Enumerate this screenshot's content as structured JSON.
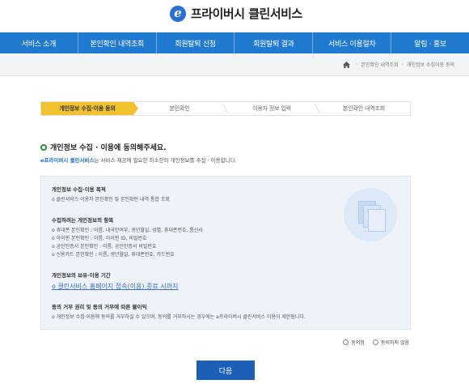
{
  "app": {
    "logo_mark": "e",
    "title": "프라이버시 클린서비스"
  },
  "nav": {
    "items": [
      "서비스 소개",
      "본인확인 내역조회",
      "회원탈퇴 신청",
      "회원탈퇴 결과",
      "서비스 이용절차",
      "알림 · 홍보"
    ]
  },
  "breadcrumb": {
    "items": [
      "본인확인 내역조회",
      "개인정보 수집이용 동의"
    ]
  },
  "steps": {
    "items": [
      "개인정보 수집·이용 동의",
      "본인확인",
      "이용자 정보 입력",
      "본인확인 내역조회"
    ],
    "active_index": 0
  },
  "main": {
    "section_title": "개인정보 수집 · 이용에 동의해주세요.",
    "intro_brand": "e프라이버시 클린서비스",
    "intro_text": "는 서비스 제공에 필요한 최소한의 개인정보를 수집 · 이용합니다."
  },
  "consent": {
    "purpose_title": "개인정보 수집·이용 목적",
    "purpose_items": [
      "o 클린서비스 이용자 본인확인 및 본인확인 내역 통합 조회"
    ],
    "items_title": "수집하려는 개인정보의 항목",
    "items_list": [
      "o 휴대폰 본인확인 : 이름, 내국인여부, 생년월일, 성별, 휴대폰번호, 통신사",
      "o 아이핀 본인확인 : 이름, 아이핀 ID, 비밀번호",
      "o 공인인증서 본인확인 : 이름, 공인인증서 비밀번호",
      "o 신용카드 본인확인 : 이름, 생년월일, 휴대폰번호, 카드번호"
    ],
    "period_title": "개인정보의 보유·이용 기간",
    "period_link": "o 클린서비스 홈페이지 접속(이용) 종료 시까지",
    "refusal_title": "동의 거부 권리 및 동의 거부에 따른 불이익",
    "refusal_text": "o 개인정보 수집·이용에 동의를 거부하실 수 있으며, 동의를 거부하시는 경우에는 e프라이버시 클린서비스 이용이 제한됩니다."
  },
  "agree": {
    "yes_label": "동의함",
    "no_label": "동의하지 않음"
  },
  "actions": {
    "next_label": "다음"
  },
  "colors": {
    "nav": "#1f7ad0",
    "active_step": "#f2c12e",
    "button": "#1d5fb8",
    "box": "#eef3fa"
  }
}
